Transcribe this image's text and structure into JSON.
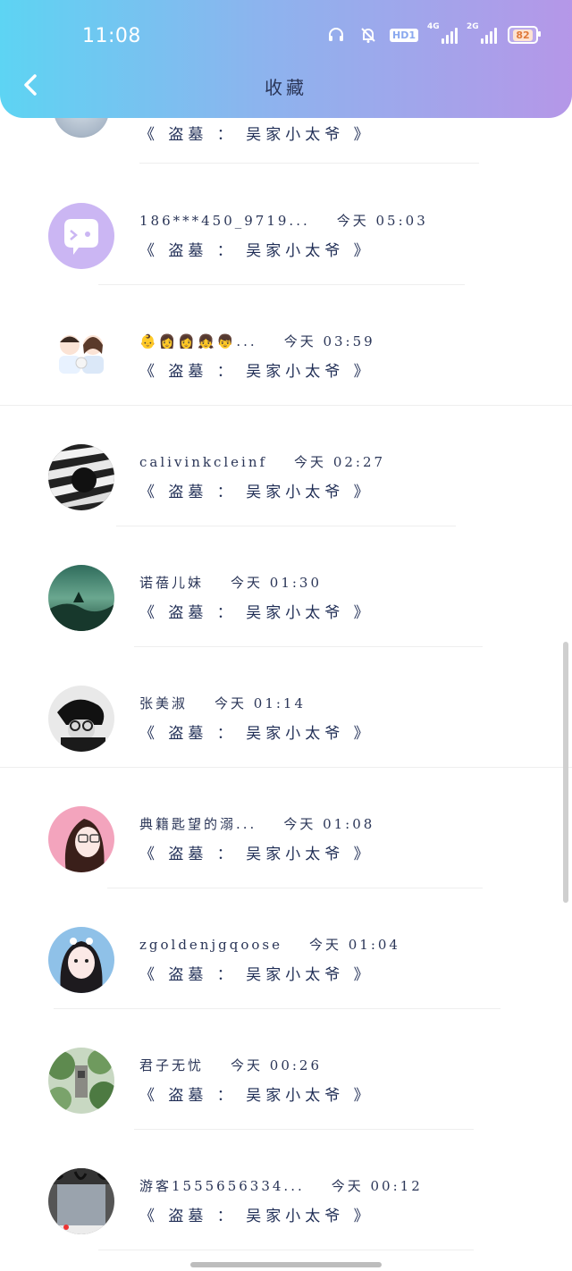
{
  "status_bar": {
    "time": "11:08",
    "hd_label": "HD1",
    "net1": "4G",
    "net2": "2G",
    "battery": "82"
  },
  "header": {
    "title": "收藏"
  },
  "partial_item": {
    "line": "《 盗墓 ： 吴家小太爷 》"
  },
  "items": [
    {
      "user": "186***450_9719...",
      "time": "今天 05:03",
      "work": "《 盗墓 ： 吴家小太爷 》",
      "avatar": "purple-chat-avatar"
    },
    {
      "user": "👶👩👩👧👦...",
      "time": "今天 03:59",
      "work": "《 盗墓 ： 吴家小太爷 》",
      "avatar": "couple-cartoon-avatar"
    },
    {
      "user": "calivinkcleinf",
      "time": "今天 02:27",
      "work": "《 盗墓 ： 吴家小太爷 》",
      "avatar": "zebra-avatar"
    },
    {
      "user": "诺蓓儿妹",
      "time": "今天 01:30",
      "work": "《 盗墓 ： 吴家小太爷 》",
      "avatar": "green-landscape-avatar"
    },
    {
      "user": "张美淑",
      "time": "今天 01:14",
      "work": "《 盗墓 ： 吴家小太爷 》",
      "avatar": "man-glasses-avatar"
    },
    {
      "user": "典籍匙望的溺...",
      "time": "今天 01:08",
      "work": "《 盗墓 ： 吴家小太爷 》",
      "avatar": "pink-girl-avatar"
    },
    {
      "user": "zgoldenjgqoose",
      "time": "今天 01:04",
      "work": "《 盗墓 ： 吴家小太爷 》",
      "avatar": "girl-sky-avatar"
    },
    {
      "user": "君子无忧",
      "time": "今天 00:26",
      "work": "《 盗墓 ： 吴家小太爷 》",
      "avatar": "forest-avatar"
    },
    {
      "user": "游客1555656334...",
      "time": "今天 00:12",
      "work": "《 盗墓 ： 吴家小太爷 》",
      "avatar": "window-photo-avatar"
    }
  ]
}
